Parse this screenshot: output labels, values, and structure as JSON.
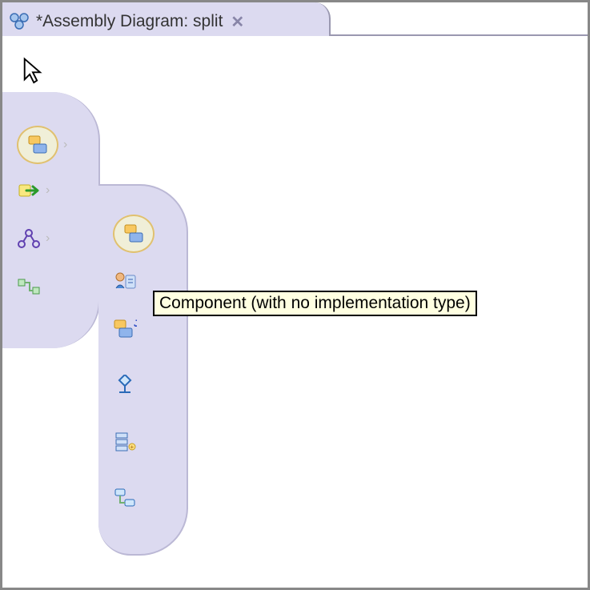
{
  "tab": {
    "title": "*Assembly Diagram: split",
    "icon": "assembly-diagram-icon"
  },
  "tooltip": {
    "text": "Component (with no implementation type)"
  },
  "palette": {
    "items": [
      {
        "name": "component-icon",
        "selected": true,
        "chevron": true
      },
      {
        "name": "import-icon",
        "selected": false,
        "chevron": true
      },
      {
        "name": "standalone-reference-icon",
        "selected": false,
        "chevron": true
      },
      {
        "name": "wire-icon",
        "selected": false,
        "chevron": false
      }
    ]
  },
  "popout": {
    "items": [
      {
        "name": "component-no-impl-icon",
        "selected": true
      },
      {
        "name": "human-task-icon",
        "selected": false
      },
      {
        "name": "java-component-icon",
        "selected": false
      },
      {
        "name": "process-icon",
        "selected": false
      },
      {
        "name": "selector-icon",
        "selected": false
      },
      {
        "name": "state-machine-icon",
        "selected": false
      }
    ]
  }
}
